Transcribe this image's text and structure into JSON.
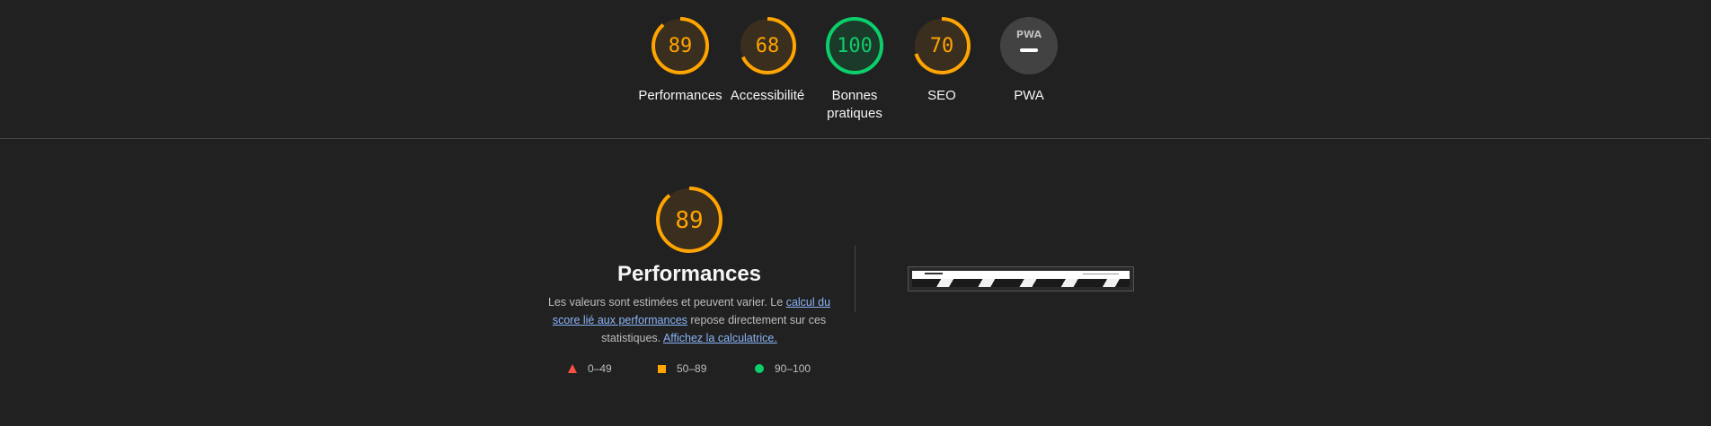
{
  "colors": {
    "average": "#ffa400",
    "pass": "#0cce6b",
    "fail": "#ff4e42",
    "na": "#9e9e9e",
    "link": "#8ab4f8"
  },
  "categories": [
    {
      "label": "Performances",
      "score": "89",
      "value": 89,
      "rating": "average"
    },
    {
      "label": "Accessibilité",
      "score": "68",
      "value": 68,
      "rating": "average"
    },
    {
      "label": "Bonnes pratiques",
      "score": "100",
      "value": 100,
      "rating": "pass"
    },
    {
      "label": "SEO",
      "score": "70",
      "value": 70,
      "rating": "average"
    },
    {
      "label": "PWA",
      "score": "",
      "value": null,
      "rating": "na",
      "badge_text": "PWA"
    }
  ],
  "performance": {
    "score": "89",
    "value": 89,
    "title": "Performances",
    "desc_part1": "Les valeurs sont estimées et peuvent varier. Le ",
    "desc_link1": "calcul du score lié aux performances",
    "desc_part2": " repose directement sur ces statistiques. ",
    "desc_link2": "Affichez la calculatrice."
  },
  "legend": [
    {
      "range": "0–49",
      "shape": "triangle-icon"
    },
    {
      "range": "50–89",
      "shape": "square-icon"
    },
    {
      "range": "90–100",
      "shape": "circle-icon"
    }
  ]
}
